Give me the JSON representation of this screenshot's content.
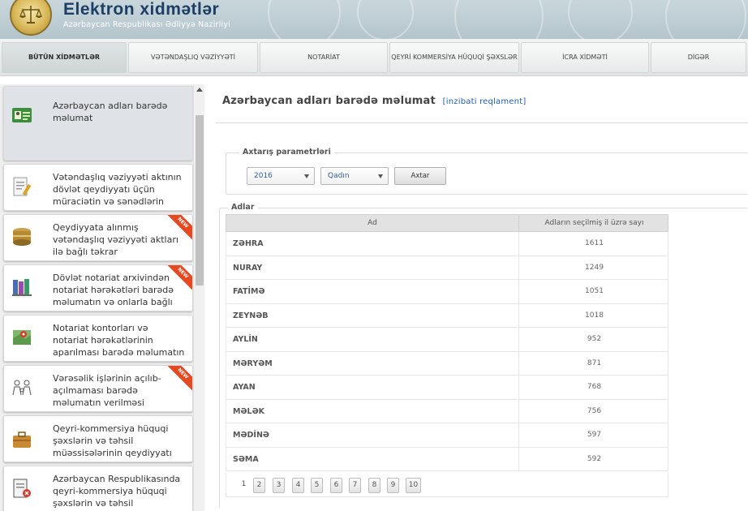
{
  "header": {
    "title": "Elektron xidmətlər",
    "subtitle": "Azərbaycan Respublikası Ədliyyə Nazirliyi"
  },
  "tabs": [
    {
      "label": "BÜTÜN XİDMƏTLƏR",
      "active": true
    },
    {
      "label": "VƏTƏNDAŞLIQ VƏZİYYƏTİ",
      "active": false
    },
    {
      "label": "NOTARİAT",
      "active": false
    },
    {
      "label": "QEYRİ KOMMERSİYA HÜQUQİ ŞƏXSLƏR",
      "active": false
    },
    {
      "label": "İCRA XİDMƏTİ",
      "active": false
    },
    {
      "label": "DİGƏR",
      "active": false
    }
  ],
  "sidebar": {
    "items": [
      {
        "label": "Azərbaycan adları barədə məlumat",
        "icon": "id-card-icon",
        "active": true,
        "new": false
      },
      {
        "label": "Vətəndaşlıq vəziyyəti aktının dövlət qeydiyyatı üçün müraciətin və sənədlərin",
        "icon": "document-pen-icon",
        "active": false,
        "new": false
      },
      {
        "label": "Qeydiyyata alınmış vətəndaşlıq vəziyyəti aktları ilə bağlı təkrar",
        "icon": "archive-stack-icon",
        "active": false,
        "new": true
      },
      {
        "label": "Dövlət notariat arxivindən notariat hərəkətləri barədə məlumatın və onlarla bağlı",
        "icon": "books-icon",
        "active": false,
        "new": true
      },
      {
        "label": "Notariat kontorları və notariat hərəkətlərinin aparılması barədə məlumatın verilməsi",
        "icon": "map-icon",
        "active": false,
        "new": false
      },
      {
        "label": "Vərəsəlik işlərinin açılıb-açılmaması barədə məlumatın verilməsi",
        "icon": "family-icon",
        "active": false,
        "new": true
      },
      {
        "label": "Qeyri-kommersiya hüquqi şəxslərin və təhsil müəssisələrinin qeydiyyatı",
        "icon": "briefcase-icon",
        "active": false,
        "new": false
      },
      {
        "label": "Azərbaycan Respublikasında qeyri-kommersiya hüquqi şəxslərin və təhsil",
        "icon": "document-remove-icon",
        "active": false,
        "new": false
      }
    ],
    "new_badge": "NEW"
  },
  "main": {
    "title": "Azərbaycan adları barədə məlumat",
    "title_link": "[inzibati reqlament]",
    "search": {
      "legend": "Axtarış parametrləri",
      "year": "2016",
      "gender": "Qadın",
      "button": "Axtar"
    },
    "results": {
      "legend": "Adlar",
      "col_name": "Ad",
      "col_count": "Adların seçilmiş il üzrə sayı",
      "rows": [
        {
          "name": "ZƏHRA",
          "count": "1611"
        },
        {
          "name": "NURAY",
          "count": "1249"
        },
        {
          "name": "FATİMƏ",
          "count": "1051"
        },
        {
          "name": "ZEYNƏB",
          "count": "1018"
        },
        {
          "name": "AYLİN",
          "count": "952"
        },
        {
          "name": "MƏRYƏM",
          "count": "871"
        },
        {
          "name": "AYAN",
          "count": "768"
        },
        {
          "name": "MƏLƏK",
          "count": "756"
        },
        {
          "name": "MƏDİNƏ",
          "count": "597"
        },
        {
          "name": "SƏMA",
          "count": "592"
        }
      ]
    },
    "pagination": {
      "current": "1",
      "pages": [
        "2",
        "3",
        "4",
        "5",
        "6",
        "7",
        "8",
        "9",
        "10"
      ]
    }
  }
}
